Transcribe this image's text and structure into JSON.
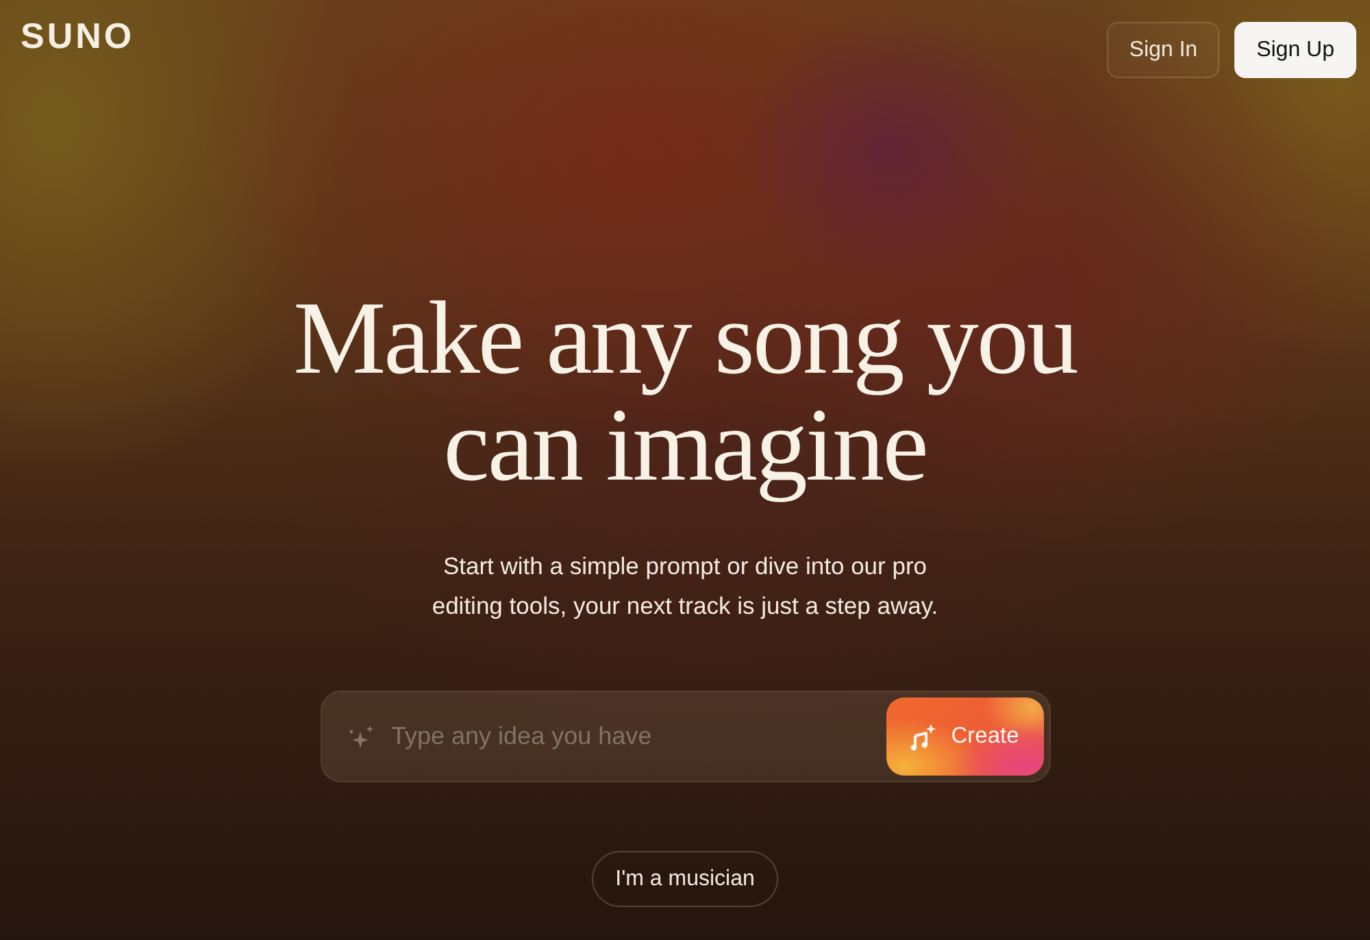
{
  "header": {
    "logo": "SUNO",
    "buttons": [
      {
        "label": "Sign In",
        "kind": "outline"
      },
      {
        "label": "Sign Up",
        "kind": "solid"
      }
    ]
  },
  "hero": {
    "title": "Make any song you can imagine",
    "subtitle": "Start with a simple prompt or dive into our pro editing tools, your next track is just a step away."
  },
  "prompt": {
    "placeholder": "Type any idea you have",
    "button": "Create"
  },
  "secondary_button": "I'm a musician"
}
